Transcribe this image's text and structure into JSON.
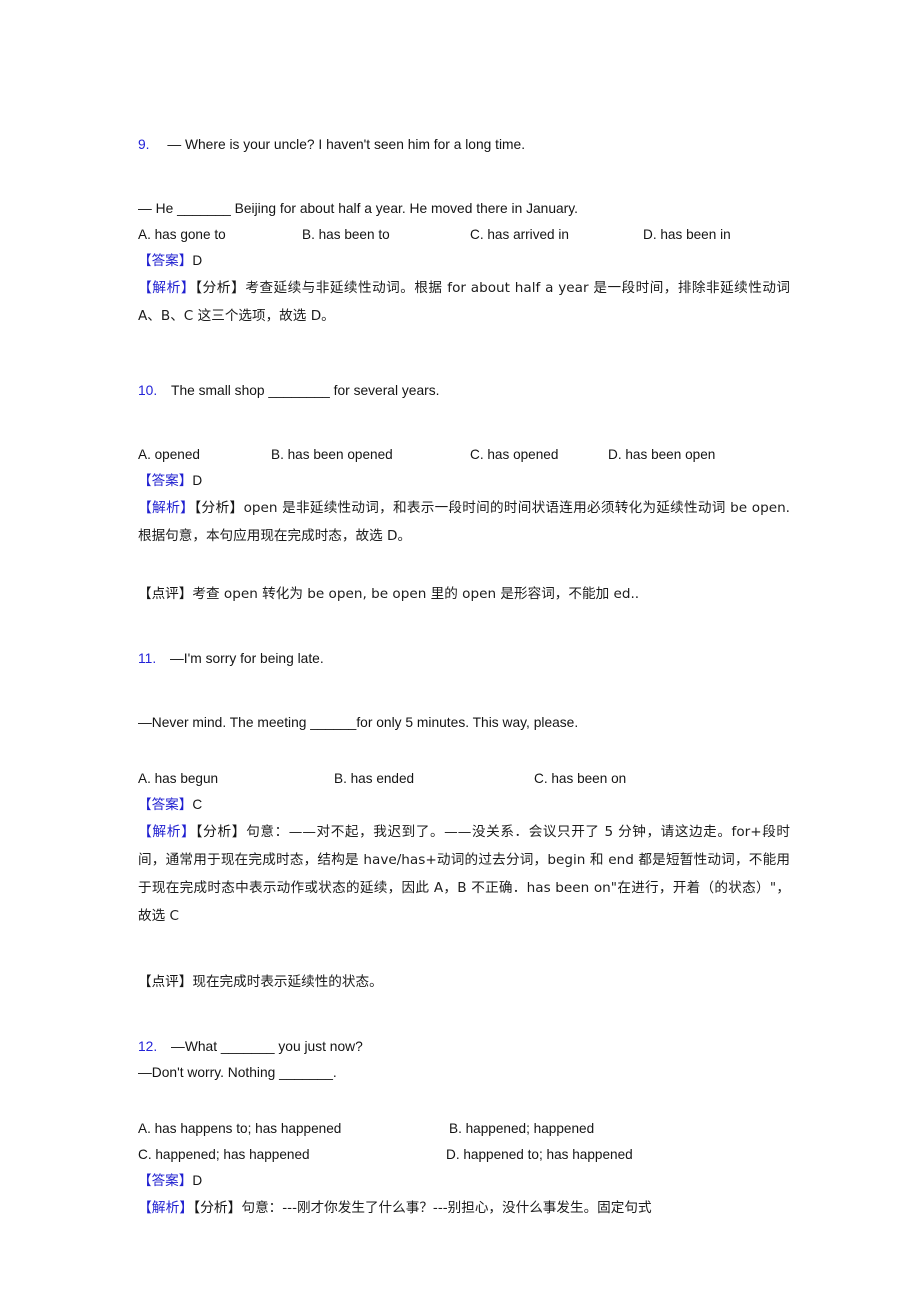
{
  "document": {
    "type": "english-grammar-exercise-worksheet",
    "language": "zh-CN/en",
    "accent_color": "#2323d8",
    "text_color": "#161616",
    "labels": {
      "answer": "【答案】",
      "analysis": "【解析】",
      "analysis_sub": "【分析】",
      "comment": "【点评】"
    }
  },
  "questions": [
    {
      "number": "9.",
      "stem_line1": "— Where is your uncle? I haven't seen him for a long time.",
      "stem_line2": "— He _______ Beijing for about half a year. He moved there in January.",
      "options": [
        "A. has gone to",
        "B. has been to",
        "C. has arrived in",
        "D. has been in"
      ],
      "answer": "D",
      "analysis": "考查延续与非延续性动词。根据 for about half a year 是一段时间，排除非延续性动词 A、B、C 这三个选项，故选 D。",
      "comment": ""
    },
    {
      "number": "10.",
      "stem_line1": "The small shop ________ for several years.",
      "stem_line2": "",
      "options": [
        "A. opened",
        "B. has been opened",
        "C. has opened",
        "D. has been open"
      ],
      "answer": "D",
      "analysis": "open 是非延续性动词，和表示一段时间的时间状语连用必须转化为延续性动词 be open.根据句意，本句应用现在完成时态，故选 D。",
      "comment": "考查 open 转化为 be open, be open 里的 open 是形容词，不能加 ed.."
    },
    {
      "number": "11.",
      "stem_line1": "—I'm sorry for being late.",
      "stem_line2": "—Never mind. The meeting ______for only 5 minutes. This way, please.",
      "options": [
        "A. has begun",
        "B. has ended",
        "C. has been on"
      ],
      "answer": "C",
      "analysis": "句意：——对不起，我迟到了。——没关系．会议只开了 5 分钟，请这边走。for+段时间，通常用于现在完成时态，结构是 have/has+动词的过去分词，begin 和 end 都是短暂性动词，不能用于现在完成时态中表示动作或状态的延续，因此 A，B 不正确．has been on\"在进行，开着（的状态）\"，故选 C",
      "comment": "现在完成时表示延续性的状态。"
    },
    {
      "number": "12.",
      "stem_line1": "—What _______ you just now?",
      "stem_line2": "—Don't worry. Nothing _______.",
      "options": [
        "A. has happens to; has happened",
        "B. happened; happened",
        "C. happened; has happened",
        "D. happened to; has happened"
      ],
      "answer": "D",
      "analysis": "句意：---刚才你发生了什么事？---别担心，没什么事发生。固定句式",
      "comment": ""
    }
  ]
}
